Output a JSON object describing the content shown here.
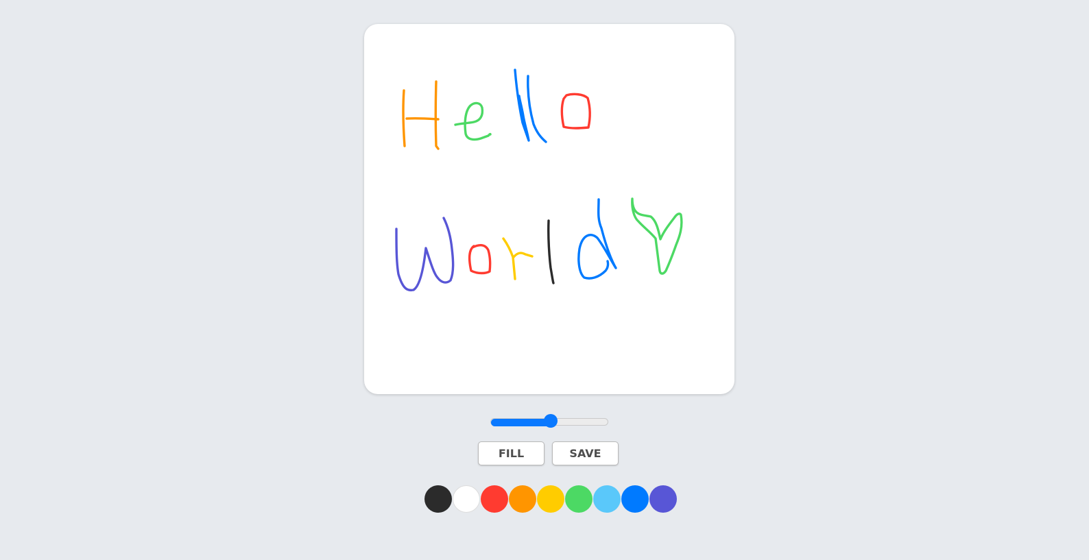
{
  "canvas": {
    "strokes": [
      {
        "name": "stroke-h",
        "color": "#ff9500"
      },
      {
        "name": "stroke-e",
        "color": "#4cd964"
      },
      {
        "name": "stroke-l1",
        "color": "#007aff"
      },
      {
        "name": "stroke-l2",
        "color": "#007aff"
      },
      {
        "name": "stroke-o",
        "color": "#ff3b30"
      },
      {
        "name": "stroke-w",
        "color": "#5856d6"
      },
      {
        "name": "stroke-o2",
        "color": "#ff3b30"
      },
      {
        "name": "stroke-r",
        "color": "#ffcc00"
      },
      {
        "name": "stroke-l3",
        "color": "#2b2b2b"
      },
      {
        "name": "stroke-d",
        "color": "#007aff"
      },
      {
        "name": "stroke-heart",
        "color": "#4cd964"
      }
    ]
  },
  "brush_size": {
    "value_fraction": 0.51,
    "accent_color": "#0a79ff"
  },
  "buttons": {
    "fill_label": "FILL",
    "save_label": "SAVE"
  },
  "palette": {
    "colors": [
      {
        "name": "black",
        "hex": "#2b2b2b"
      },
      {
        "name": "white",
        "hex": "#ffffff"
      },
      {
        "name": "red",
        "hex": "#ff3b30"
      },
      {
        "name": "orange",
        "hex": "#ff9500"
      },
      {
        "name": "yellow",
        "hex": "#ffcc00"
      },
      {
        "name": "green",
        "hex": "#4cd964"
      },
      {
        "name": "light-blue",
        "hex": "#5ac8fa"
      },
      {
        "name": "blue",
        "hex": "#007aff"
      },
      {
        "name": "purple",
        "hex": "#5856d6"
      }
    ]
  }
}
